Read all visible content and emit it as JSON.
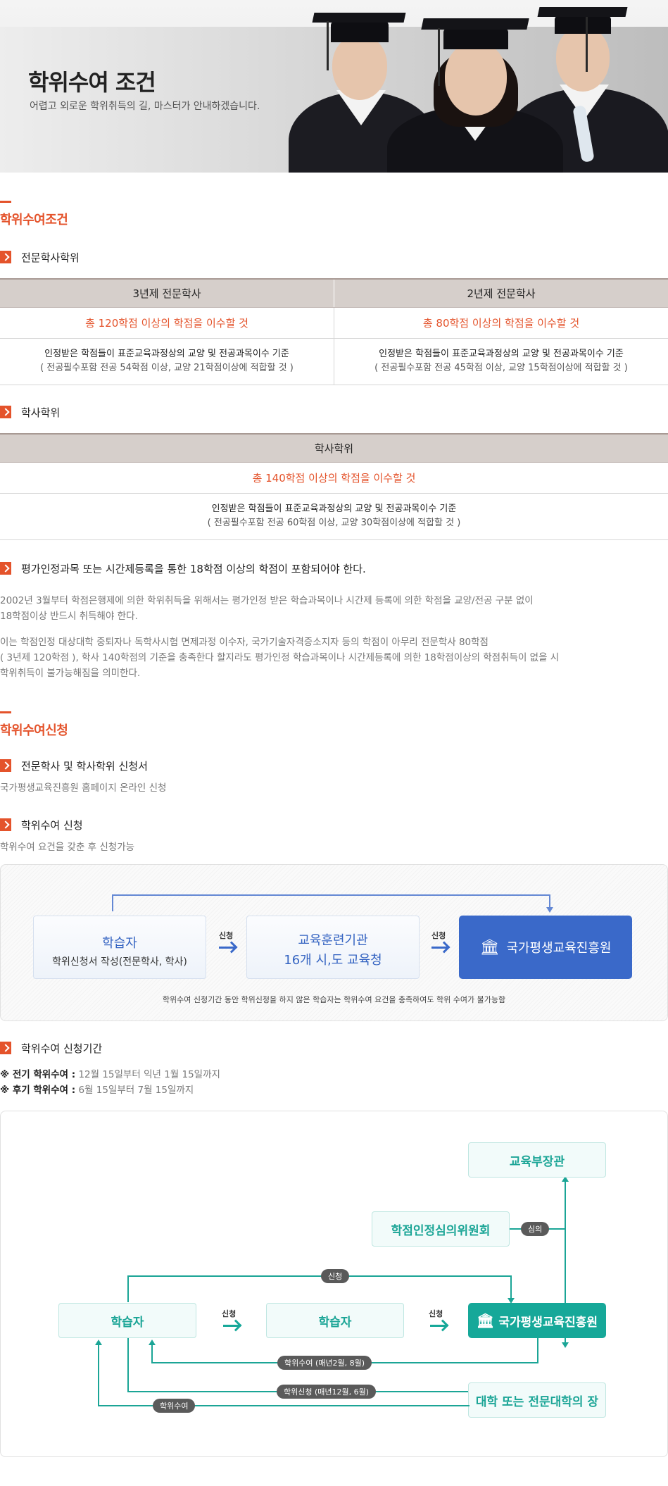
{
  "banner": {
    "title": "학위수여 조건",
    "subtitle": "어렵고 외로운 학위취득의 길, 마스터가 안내하겠습니다."
  },
  "section1": {
    "title": "학위수여조건"
  },
  "sub_professional": "전문학사학위",
  "table_professional": {
    "headers": [
      "3년제 전문학사",
      "2년제 전문학사"
    ],
    "requirements": [
      "총 120학점 이상의 학점을 이수할 것",
      "총 80학점 이상의 학점을 이수할 것"
    ],
    "desc_main": [
      "인정받은 학점들이 표준교육과정상의 교양 및 전공과목이수 기준",
      "인정받은 학점들이 표준교육과정상의 교양 및 전공과목이수 기준"
    ],
    "desc_sub": [
      "( 전공필수포함 전공 54학점 이상, 교양 21학점이상에 적합할 것 )",
      "( 전공필수포함 전공 45학점 이상, 교양 15학점이상에 적합할 것 )"
    ]
  },
  "sub_bachelor": "학사학위",
  "table_bachelor": {
    "header": "학사학위",
    "requirement": "총 140학점 이상의 학점을 이수할 것",
    "desc_main": "인정받은 학점들이 표준교육과정상의 교양 및 전공과목이수 기준",
    "desc_sub": "( 전공필수포함 전공 60학점 이상, 교양 30학점이상에 적합할 것 )"
  },
  "sub_note": "평가인정과목 또는 시간제등록을 통한 18학점 이상의 학점이 포함되어야 한다.",
  "note_p1": [
    "2002년 3월부터 학점은행제에 의한 학위취득을 위해서는 평가인정 받은 학습과목이나 시간제 등록에 의한 학점을 교양/전공 구분 없이",
    "18학점이상 반드시 취득해야 한다."
  ],
  "note_p2": [
    "이는 학점인정 대상대학 중퇴자나 독학사시험 면제과정 이수자, 국가기술자격증소지자 등의 학점이 아무리 전문학사 80학점",
    "( 3년제 120학점 ), 학사 140학점의 기준을 충족한다 할지라도 평가인정 학습과목이나 시간제등록에 의한 18학점이상의 학점취득이 없을 시",
    "학위취득이 불가능해짐을 의미한다."
  ],
  "section2": {
    "title": "학위수여신청"
  },
  "sub_apply_form": "전문학사 및 학사학위 신청서",
  "apply_form_text": "국가평생교육진흥원 홈페이지 온라인 신청",
  "sub_apply": "학위수여 신청",
  "apply_text": "학위수여 요건을 갖춘 후 신청가능",
  "flow1": {
    "box1_title": "학습자",
    "box1_sub": "학위신청서 작성(전문학사, 학사)",
    "step1": "신청",
    "box2_line1": "교육훈련기관",
    "box2_line2": "16개 시,도 교육청",
    "step2": "신청",
    "box3": "국가평생교육진흥원",
    "note": "학위수여 신청기간 동안 학위신청을 하지 않은 학습자는 학위수여 요건을 충족하여도 학위 수여가 불가능함"
  },
  "sub_period": "학위수여 신청기간",
  "period": [
    {
      "label": "※ 전기 학위수여 :",
      "value": " 12월 15일부터 익년 1월 15일까지"
    },
    {
      "label": "※ 후기 학위수여 :",
      "value": " 6월 15일부터 7월 15일까지"
    }
  ],
  "flow2": {
    "ministry": "교육부장관",
    "committee": "학점인정심의위원회",
    "review": "심의",
    "apply_top": "신청",
    "learner1": "학습자",
    "step1": "신청",
    "learner2": "학습자",
    "step2": "신청",
    "nile": "국가평생교육진흥원",
    "award": "학위수여 (매년2월, 8월)",
    "apply_period": "학위신청 (매년12월, 6월)",
    "univ": "대학 또는 전문대학의 장",
    "award2": "학위수여"
  }
}
